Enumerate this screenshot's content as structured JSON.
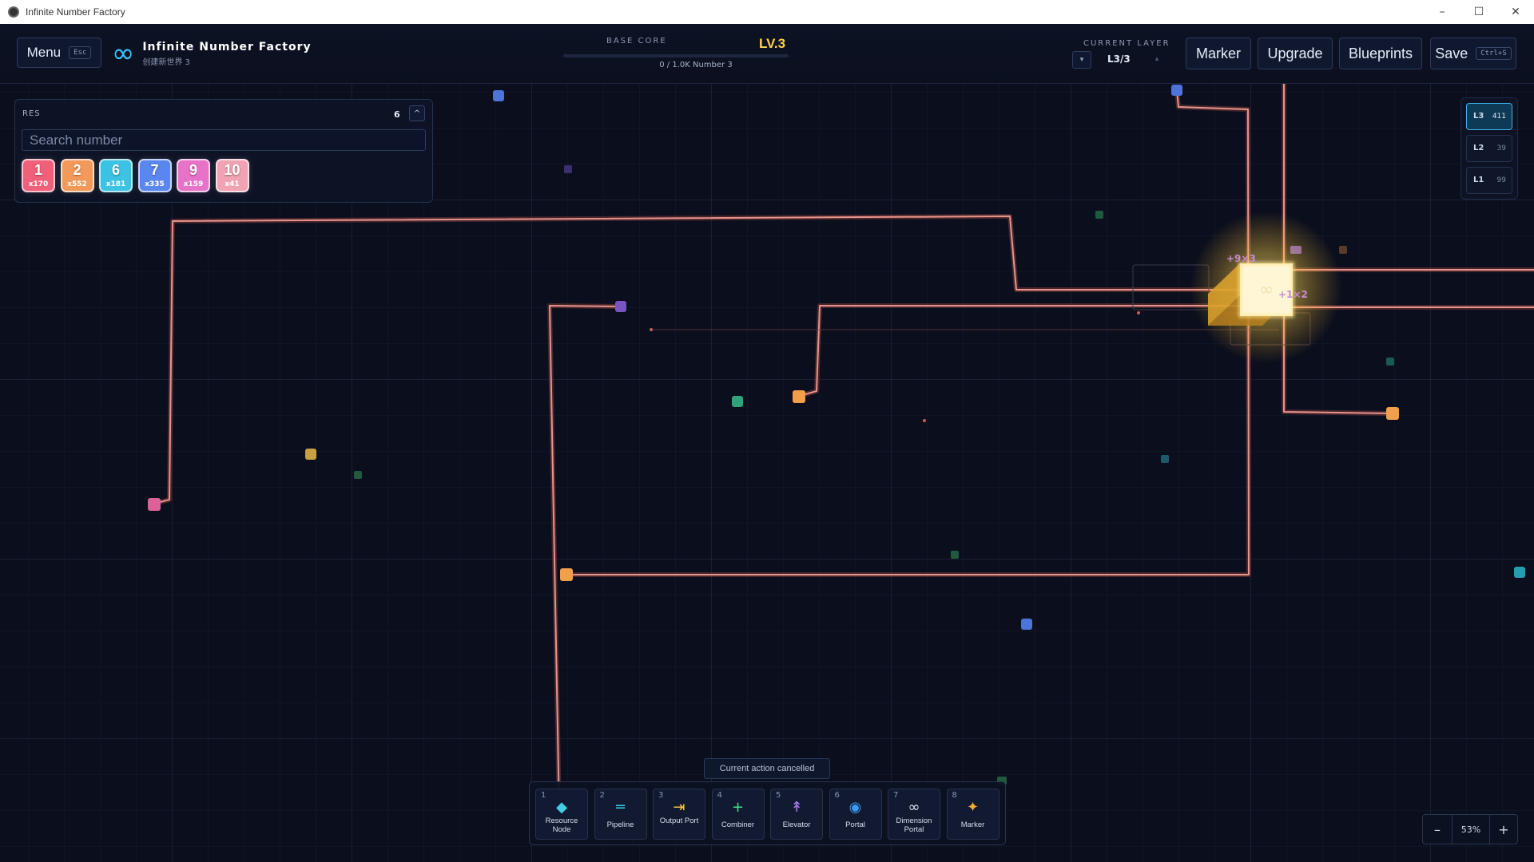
{
  "window": {
    "title": "Infinite Number Factory",
    "minimize": "–",
    "maximize": "☐",
    "close": "✕"
  },
  "hud": {
    "menu_label": "Menu",
    "menu_key": "Esc",
    "brand_icon": "∞",
    "brand_title": "Infinite Number Factory",
    "brand_subtitle": "创建新世界 3",
    "base_core_label": "BASE CORE",
    "base_core_level": "LV.3",
    "base_core_progress": "0 / 1.0K Number 3",
    "base_core_progress_fraction": 0,
    "current_layer_label": "CURRENT LAYER",
    "current_layer_value": "L3/3",
    "layer_down": "▾",
    "layer_up": "▴",
    "marker_label": "Marker",
    "upgrade_label": "Upgrade",
    "blueprints_label": "Blueprints",
    "save_label": "Save",
    "save_key": "Ctrl+S"
  },
  "resources": {
    "title": "RES",
    "count": "6",
    "collapse": "^",
    "search_placeholder": "Search number",
    "items": [
      {
        "number": "1",
        "qty": "x170",
        "color": "#f0607a"
      },
      {
        "number": "2",
        "qty": "x552",
        "color": "#f39a5a"
      },
      {
        "number": "6",
        "qty": "x181",
        "color": "#3cc3e3"
      },
      {
        "number": "7",
        "qty": "x335",
        "color": "#5a86f0"
      },
      {
        "number": "9",
        "qty": "x159",
        "color": "#e872c8"
      },
      {
        "number": "10",
        "qty": "x41",
        "color": "#f0a3b2"
      }
    ]
  },
  "layers": [
    {
      "name": "L3",
      "count": "411",
      "active": true
    },
    {
      "name": "L2",
      "count": "39",
      "active": false
    },
    {
      "name": "L1",
      "count": "99",
      "active": false
    }
  ],
  "core_labels": {
    "top": "+9×3",
    "right": "+1×2"
  },
  "toast": "Current action cancelled",
  "tools": [
    {
      "key": "1",
      "label": "Resource Node",
      "icon": "◆",
      "color": "#3fd0e8"
    },
    {
      "key": "2",
      "label": "Pipeline",
      "icon": "═",
      "color": "#3fd0e8"
    },
    {
      "key": "3",
      "label": "Output Port",
      "icon": "⇥",
      "color": "#f3c545"
    },
    {
      "key": "4",
      "label": "Combiner",
      "icon": "+",
      "color": "#3fe08a"
    },
    {
      "key": "5",
      "label": "Elevator",
      "icon": "↟",
      "color": "#b07cf5"
    },
    {
      "key": "6",
      "label": "Portal",
      "icon": "◉",
      "color": "#3b9af5"
    },
    {
      "key": "7",
      "label": "Dimension Portal",
      "icon": "∞",
      "color": "#e0e6f5"
    },
    {
      "key": "8",
      "label": "Marker",
      "icon": "✦",
      "color": "#f3a83a"
    }
  ],
  "zoom": {
    "minus": "–",
    "value": "53%",
    "plus": "+"
  },
  "colors": {
    "accent": "#38c7ff",
    "pipe": "#d37a72",
    "core": "#ffd24a"
  }
}
